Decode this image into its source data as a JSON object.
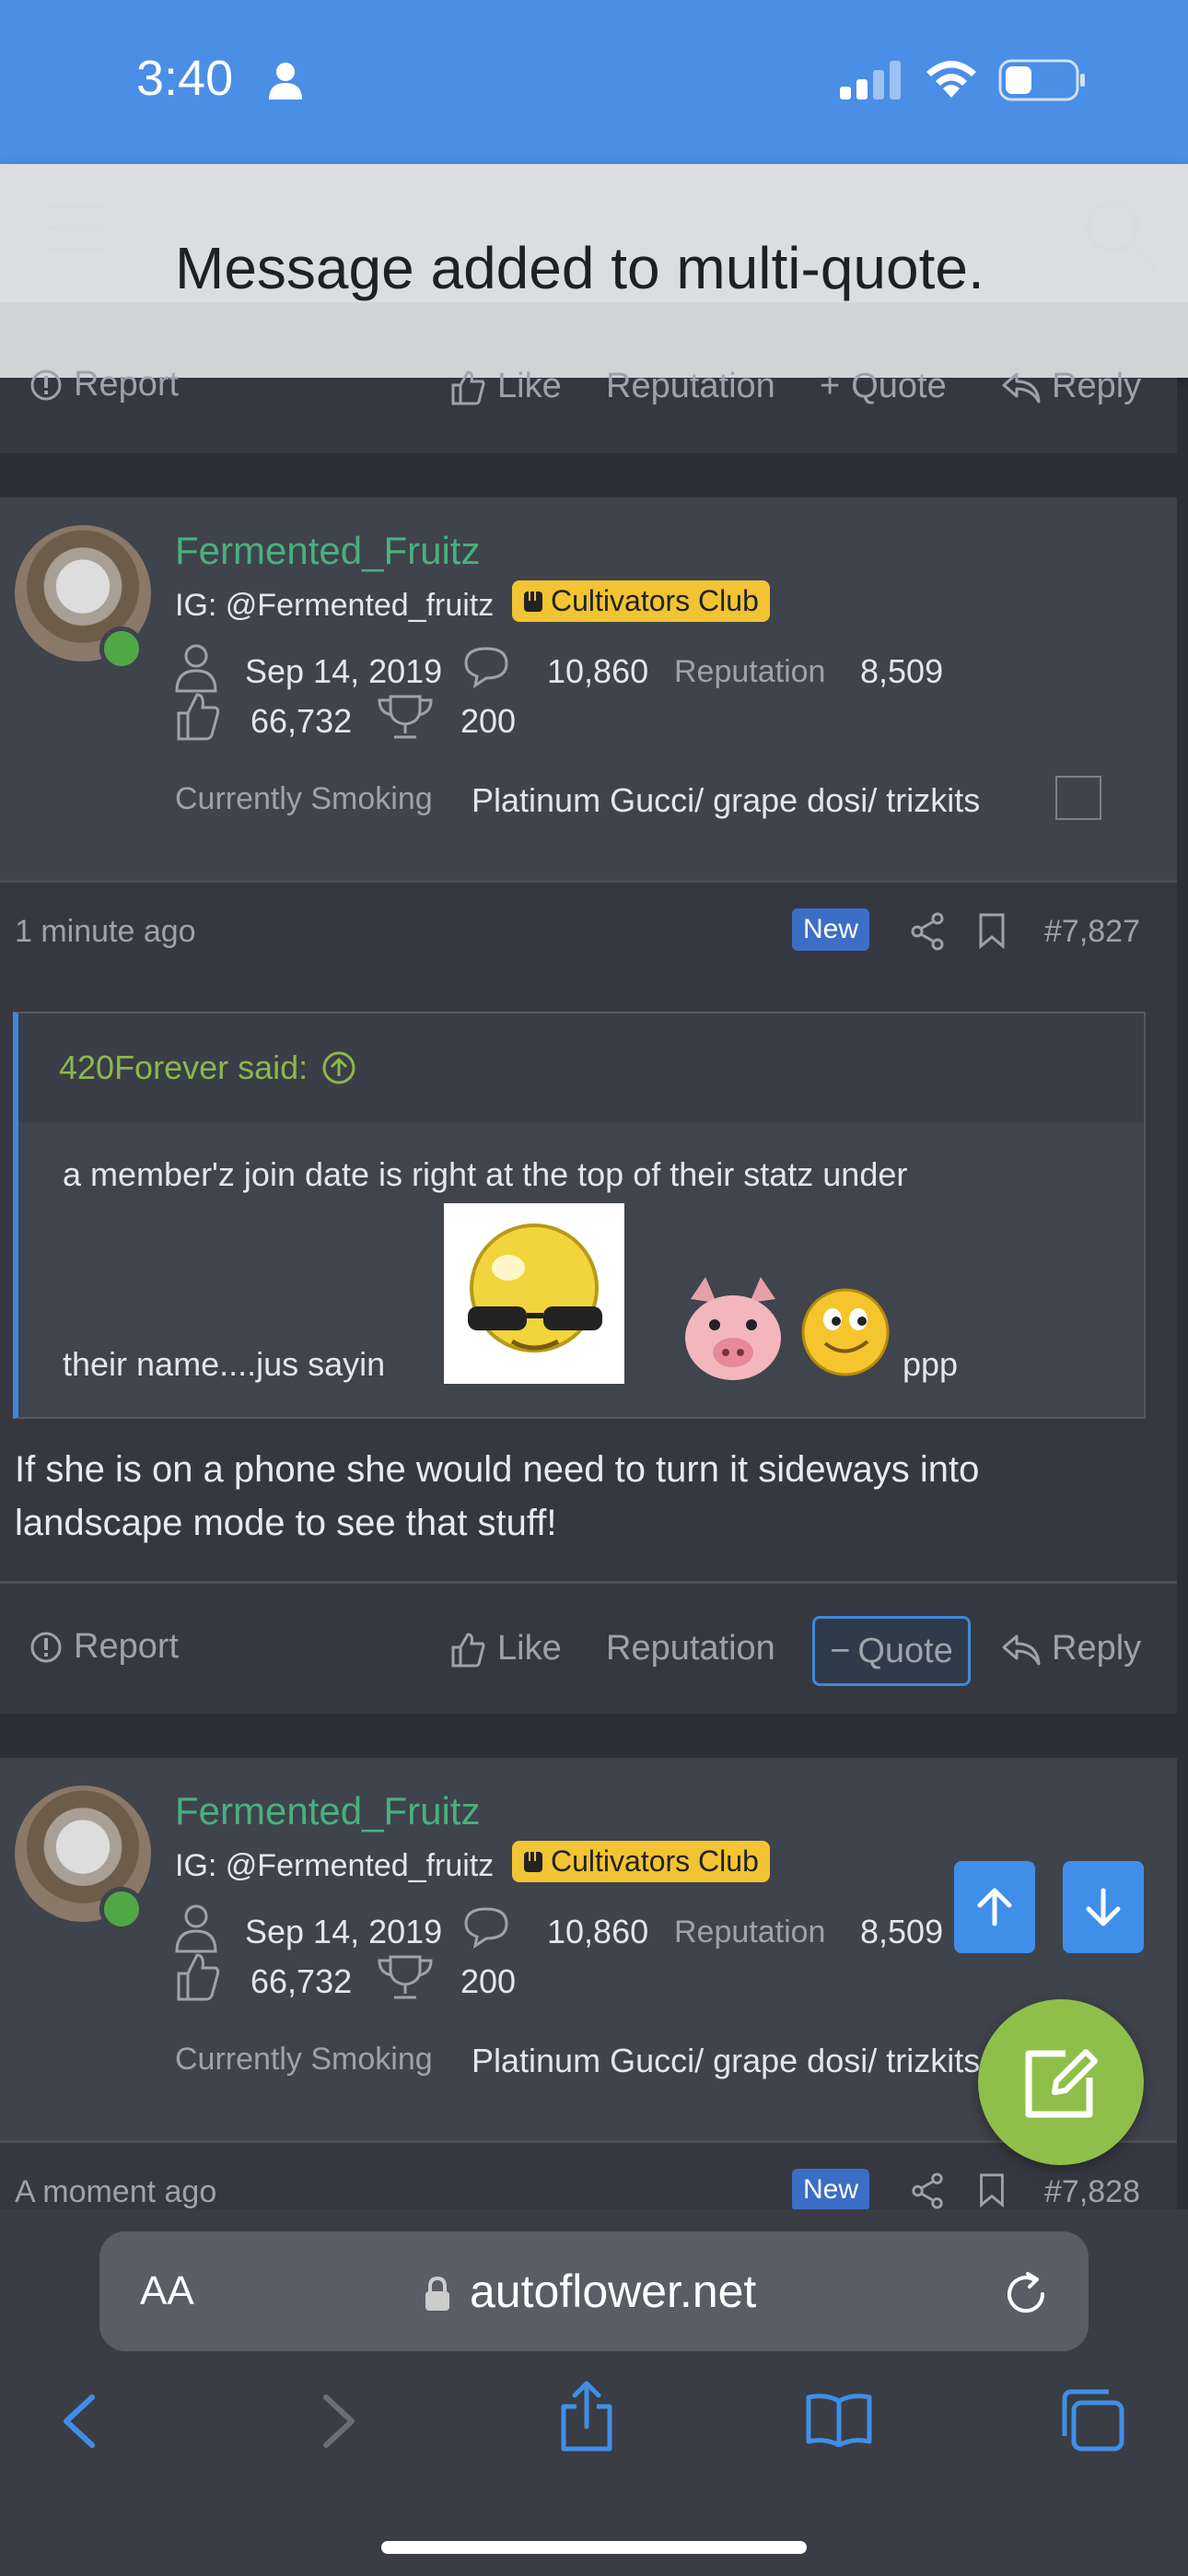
{
  "status_bar": {
    "time": "3:40"
  },
  "toast": {
    "message": "Message added to multi-quote."
  },
  "prev_post_footer": {
    "report": "Report",
    "like": "Like",
    "reputation": "Reputation",
    "quote": "Quote",
    "reply": "Reply"
  },
  "post1": {
    "username": "Fermented_Fruitz",
    "ig": "IG: @Fermented_fruitz",
    "badge": "Cultivators Club",
    "join_date": "Sep 14, 2019",
    "messages": "10,860",
    "reputation_label": "Reputation",
    "reputation": "8,509",
    "likes": "66,732",
    "trophies": "200",
    "smoking_label": "Currently Smoking",
    "smoking_value": "Platinum Gucci/ grape dosi/ trizkits",
    "time": "1 minute ago",
    "new_badge": "New",
    "post_number": "#7,827",
    "quote_author": "420Forever said:",
    "quote_line1": "a member'z join date is right at the top of their statz under",
    "quote_line2": "their name....jus sayin",
    "quote_tail": "ppp",
    "body": "If she is on a phone she would need to turn it sideways into landscape mode to see that stuff!",
    "actions": {
      "report": "Report",
      "like": "Like",
      "reputation": "Reputation",
      "quote": "Quote",
      "reply": "Reply"
    }
  },
  "post2": {
    "username": "Fermented_Fruitz",
    "ig": "IG: @Fermented_fruitz",
    "badge": "Cultivators Club",
    "join_date": "Sep 14, 2019",
    "messages": "10,860",
    "reputation_label": "Reputation",
    "reputation": "8,509",
    "likes": "66,732",
    "trophies": "200",
    "smoking_label": "Currently Smoking",
    "smoking_value": "Platinum Gucci/ grape dosi/ trizkits",
    "time": "A moment ago",
    "new_badge": "New",
    "post_number": "#7,828"
  },
  "browser": {
    "aa": "AA",
    "url": "autoflower.net"
  },
  "colors": {
    "accent": "#3f8fe8",
    "username": "#49b07e",
    "fab": "#8fbf4a",
    "badge": "#f2c433"
  },
  "icons": [
    "person-icon",
    "signal-icon",
    "wifi-icon",
    "battery-icon",
    "menu-icon",
    "search-icon",
    "report-icon",
    "like-icon",
    "quote-icon",
    "reply-icon",
    "user-icon",
    "messages-icon",
    "trophy-icon",
    "share-icon",
    "bookmark-icon",
    "arrow-up-icon",
    "arrow-down-icon",
    "compose-icon",
    "lock-icon",
    "reload-icon",
    "back-icon",
    "forward-icon",
    "share-sheet-icon",
    "bookmarks-icon",
    "tabs-icon"
  ]
}
